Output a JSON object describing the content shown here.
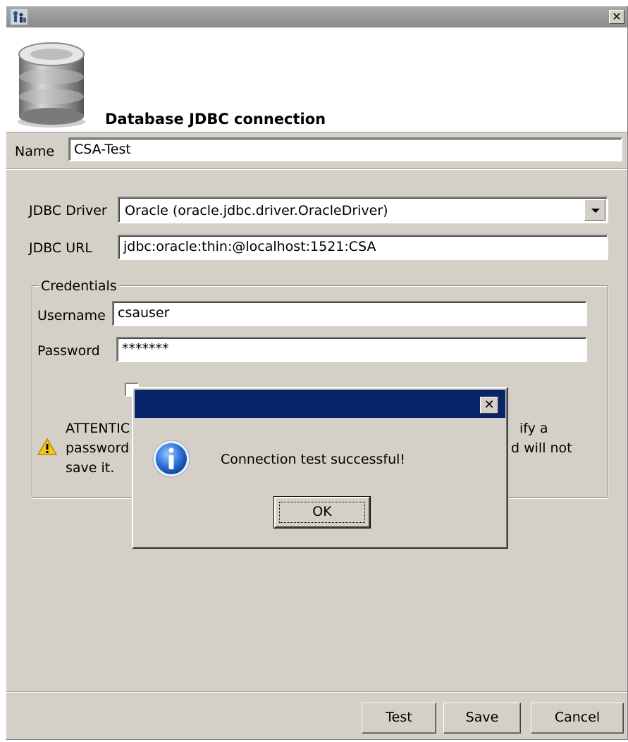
{
  "window": {
    "title": "",
    "close_glyph": "✕"
  },
  "header": {
    "title": "Database JDBC connection",
    "icon": "database-icon"
  },
  "name": {
    "label": "Name",
    "value": "CSA-Test"
  },
  "driver": {
    "label": "JDBC Driver",
    "value": "Oracle (oracle.jdbc.driver.OracleDriver)"
  },
  "url": {
    "label": "JDBC URL",
    "value": "jdbc:oracle:thin:@localhost:1521:CSA"
  },
  "credentials": {
    "legend": "Credentials",
    "username_label": "Username",
    "username_value": "csauser",
    "password_label": "Password",
    "password_value": "*******",
    "warning_line1": "ATTENTIC",
    "warning_line1_right": "ify a",
    "warning_line2": "password",
    "warning_line2_right": "d will not",
    "warning_line3": "save it."
  },
  "buttons": {
    "test": "Test",
    "save": "Save",
    "cancel": "Cancel"
  },
  "message_box": {
    "text": "Connection test successful!",
    "ok": "OK",
    "close_glyph": "✕",
    "icon": "info-icon"
  },
  "colors": {
    "dialog_bg": "#d4d0c8",
    "msg_titlebar": "#0a246a"
  }
}
